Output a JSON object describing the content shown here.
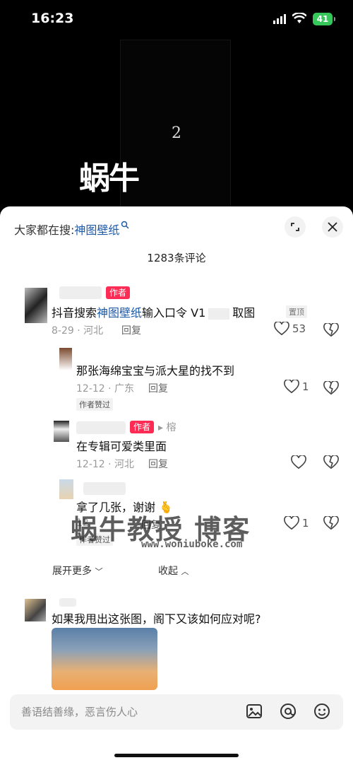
{
  "status": {
    "time": "16:23",
    "battery": "41"
  },
  "video": {
    "number": "2",
    "logo": "蜗牛"
  },
  "sheet": {
    "search_prefix": "大家都在搜:",
    "search_keyword": "神图壁纸",
    "count": "1283条评论"
  },
  "comments": [
    {
      "tag": "作者",
      "body_pre": "抖音搜索",
      "body_kw": "神图壁纸",
      "body_post": "输入口令 V1",
      "body_tail": "取图",
      "pin": "置顶",
      "meta": "8-29 · 河北",
      "reply": "回复",
      "likes": "53"
    },
    {
      "body": "那张海绵宝宝与派大星的找不到",
      "meta": "12-12 · 广东",
      "reply": "回复",
      "likes": "1",
      "praise": "作者赞过"
    },
    {
      "tag": "作者",
      "reply_to": "榕",
      "body": "在专辑可爱类里面",
      "meta": "12-12 · 河北",
      "reply": "回复"
    },
    {
      "body": "拿了几张，谢谢 🫰",
      "meta": "12",
      "reply": "回复",
      "likes": "1",
      "praise": "作者赞过"
    },
    {
      "body": "如果我甩出这张图，阁下又该如何应对呢?"
    }
  ],
  "thread": {
    "expand": "展开更多",
    "collapse": "收起"
  },
  "input": {
    "placeholder": "善语结善缘，恶言伤人心"
  },
  "watermark": {
    "big": "蜗牛教授 博客",
    "url": "www.woniuboke.com"
  },
  "colors": {
    "accent": "#1e5aa6",
    "author_tag": "#fe2c55",
    "battery": "#35c759"
  },
  "icons": [
    "search-icon",
    "expand-icon",
    "close-icon",
    "heart-icon",
    "dislike-icon",
    "image-icon",
    "at-icon",
    "emoji-icon"
  ]
}
